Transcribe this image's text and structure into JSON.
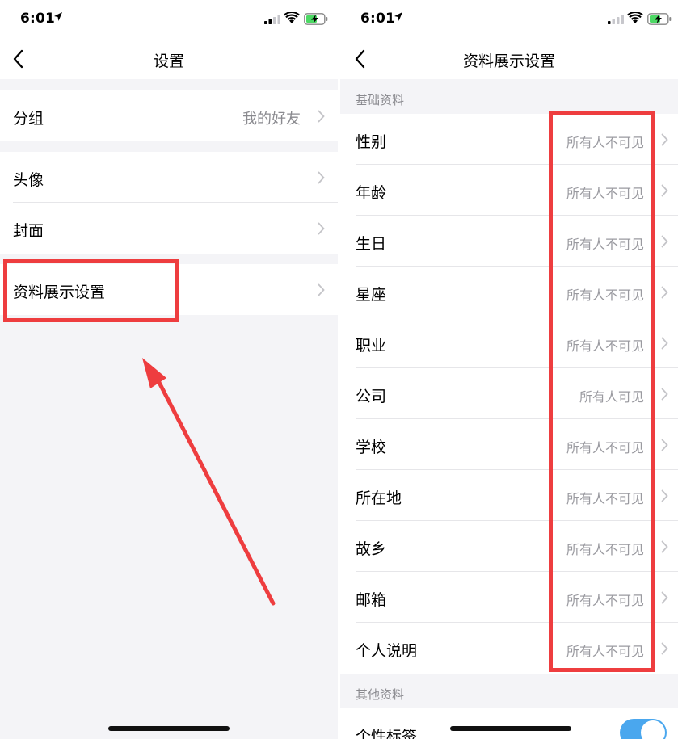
{
  "left_screen": {
    "status_bar": {
      "time": "6:01"
    },
    "nav": {
      "title": "设置"
    },
    "rows": [
      {
        "label": "分组",
        "value": "我的好友"
      },
      {
        "label": "头像"
      },
      {
        "label": "封面"
      },
      {
        "label": "资料展示设置"
      }
    ]
  },
  "right_screen": {
    "status_bar": {
      "time": "6:01"
    },
    "nav": {
      "title": "资料展示设置"
    },
    "basic_section": {
      "header": "基础资料",
      "rows": [
        {
          "label": "性别",
          "value": "所有人不可见"
        },
        {
          "label": "年龄",
          "value": "所有人不可见"
        },
        {
          "label": "生日",
          "value": "所有人不可见"
        },
        {
          "label": "星座",
          "value": "所有人不可见"
        },
        {
          "label": "职业",
          "value": "所有人不可见"
        },
        {
          "label": "公司",
          "value": "所有人可见"
        },
        {
          "label": "学校",
          "value": "所有人不可见"
        },
        {
          "label": "所在地",
          "value": "所有人不可见"
        },
        {
          "label": "故乡",
          "value": "所有人不可见"
        },
        {
          "label": "邮箱",
          "value": "所有人不可见"
        },
        {
          "label": "个人说明",
          "value": "所有人不可见"
        }
      ]
    },
    "other_section": {
      "header": "其他资料",
      "rows": [
        {
          "label": "个性标签",
          "toggle": true
        }
      ]
    }
  },
  "colors": {
    "annotation": "#ee3d3f",
    "toggle_on": "#4aa7ee",
    "secondary_text": "#8a8a8f",
    "background": "#f4f4f7"
  },
  "icons": [
    "location-arrow-icon",
    "signal-icon",
    "wifi-icon",
    "battery-charging-icon",
    "back-chevron-icon",
    "chevron-right-icon"
  ]
}
